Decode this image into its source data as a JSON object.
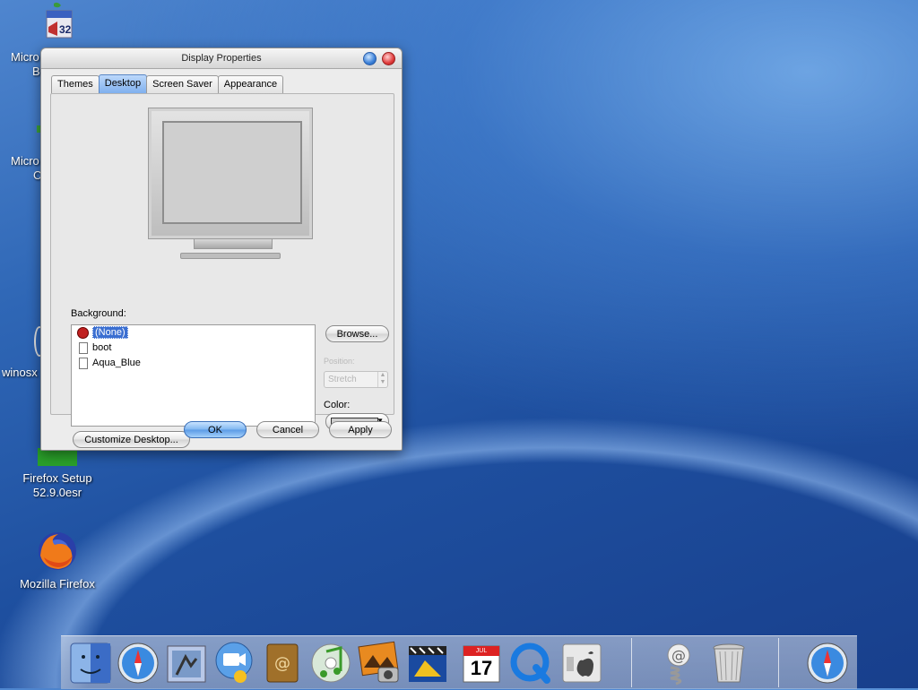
{
  "desktop": {
    "icons": [
      {
        "label_line1": "Micro",
        "label_line2": "B"
      },
      {
        "label_line1": "Micro",
        "label_line2": "C"
      },
      {
        "label_line1": "winosx",
        "label_line2": ""
      },
      {
        "label_line1": "Firefox Setup",
        "label_line2": "52.9.0esr"
      },
      {
        "label_line1": "Mozilla Firefox",
        "label_line2": ""
      }
    ],
    "badge_32": "32"
  },
  "dialog": {
    "title": "Display Properties",
    "tabs": [
      "Themes",
      "Desktop",
      "Screen Saver",
      "Appearance"
    ],
    "active_tab": "Desktop",
    "background_label": "Background:",
    "background_items": [
      "(None)",
      "boot",
      "Aqua_Blue"
    ],
    "selected_background": "(None)",
    "browse_label": "Browse...",
    "position_label": "Position:",
    "position_value": "Stretch",
    "color_label": "Color:",
    "color_value": "#cfcfcf",
    "customize_label": "Customize Desktop...",
    "ok_label": "OK",
    "cancel_label": "Cancel",
    "apply_label": "Apply"
  },
  "dock": {
    "items": [
      "finder-icon",
      "safari-icon",
      "mail-icon",
      "ichat-icon",
      "address-book-icon",
      "itunes-icon",
      "iphoto-icon",
      "imovie-icon",
      "ical-icon",
      "quicktime-icon",
      "system-preferences-icon",
      "mail-spring-icon",
      "trash-icon",
      "safari-icon"
    ],
    "ical_month": "JUL",
    "ical_day": "17"
  }
}
